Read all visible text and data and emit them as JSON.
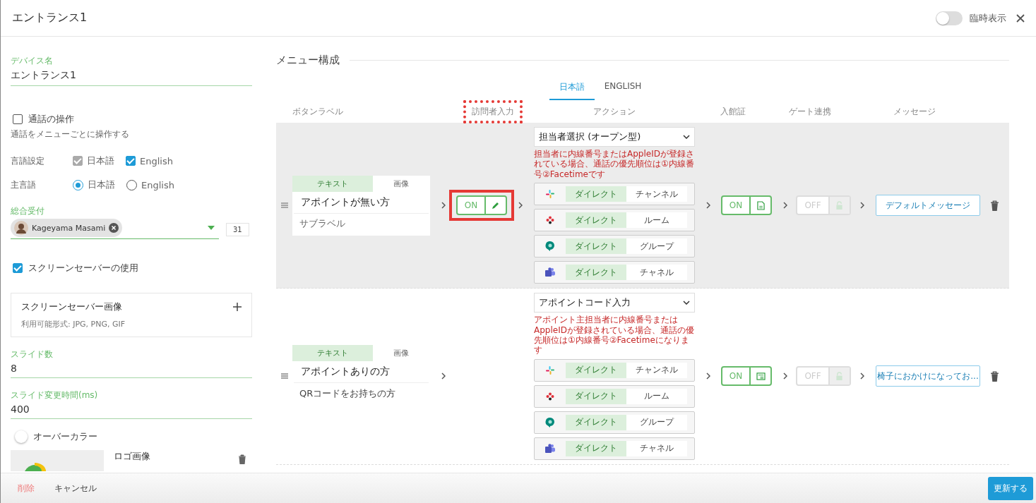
{
  "window": {
    "title": "エントランス1",
    "temp_display": {
      "label": "臨時表示",
      "on": false
    }
  },
  "settings": {
    "device_name": {
      "label": "デバイス名",
      "value": "エントランス1"
    },
    "call_control": {
      "label": "通話の操作",
      "checked": false,
      "hint": "通話をメニューごとに操作する"
    },
    "languages": {
      "label": "言語設定",
      "options": [
        {
          "label": "日本語",
          "checked": true,
          "disabled": true
        },
        {
          "label": "English",
          "checked": true,
          "disabled": false
        }
      ]
    },
    "main_language": {
      "label": "主言語",
      "options": [
        {
          "label": "日本語",
          "selected": true
        },
        {
          "label": "English",
          "selected": false
        }
      ]
    },
    "reception": {
      "label": "総合受付",
      "chips": [
        "Kageyama Masami"
      ],
      "count": "31"
    },
    "screensaver": {
      "label": "スクリーンセーバーの使用",
      "checked": true
    },
    "screensaver_image": {
      "title": "スクリーンセーバー画像",
      "hint": "利用可能形式: JPG, PNG, GIF"
    },
    "slide_count": {
      "label": "スライド数",
      "value": "8"
    },
    "slide_interval": {
      "label": "スライド変更時間(ms)",
      "value": "400"
    },
    "over_color": {
      "label": "オーバーカラー",
      "on": false
    },
    "logo": {
      "label": "ロゴ画像",
      "kind": "picture"
    }
  },
  "menu": {
    "title": "メニュー構成",
    "language_tabs": [
      {
        "label": "日本語",
        "selected": true
      },
      {
        "label": "ENGLISH",
        "selected": false
      }
    ],
    "columns": [
      {
        "label": "ボタンラベル",
        "dotted_frame": false
      },
      {
        "label": "訪問者入力",
        "dotted_frame": true
      },
      {
        "label": "アクション",
        "dotted_frame": false
      },
      {
        "label": "入館証",
        "dotted_frame": false
      },
      {
        "label": "ゲート連携",
        "dotted_frame": false
      },
      {
        "label": "メッセージ",
        "dotted_frame": false
      }
    ],
    "rows": [
      {
        "highlighted": true,
        "label_mode_tabs": [
          {
            "label": "テキスト",
            "selected": true
          },
          {
            "label": "画像",
            "selected": false
          }
        ],
        "label": "アポイントが無い方",
        "sublabel": {
          "placeholder": "サブラベル"
        },
        "visitor_input": {
          "label": "ON",
          "on": true,
          "framed": true
        },
        "action": {
          "value": "担当者選択 (オープン型)",
          "note": "担当者に内線番号またはAppleIDが登録されている場合、通話の優先順位は①内線番号②Facetimeです",
          "channels": [
            {
              "kind": "pinwheel",
              "options": [
                {
                  "label": "ダイレクト",
                  "selected": true
                },
                {
                  "label": "チャンネル",
                  "selected": false
                }
              ]
            },
            {
              "kind": "flower",
              "options": [
                {
                  "label": "ダイレクト",
                  "selected": true
                },
                {
                  "label": "ルーム",
                  "selected": false
                }
              ]
            },
            {
              "kind": "bubble",
              "options": [
                {
                  "label": "ダイレクト",
                  "selected": true
                },
                {
                  "label": "グループ",
                  "selected": false
                }
              ]
            },
            {
              "kind": "team",
              "options": [
                {
                  "label": "ダイレクト",
                  "selected": true
                },
                {
                  "label": "チャネル",
                  "selected": false
                }
              ]
            }
          ]
        },
        "pass": {
          "label": "ON",
          "on": true,
          "kind": "document"
        },
        "gate": {
          "label": "OFF",
          "disabled": true
        },
        "message": "デフォルトメッセージ"
      },
      {
        "highlighted": false,
        "label_mode_tabs": [
          {
            "label": "テキスト",
            "selected": true
          },
          {
            "label": "画像",
            "selected": false
          }
        ],
        "label": "アポイントありの方",
        "sublabel": {
          "value": "QRコードをお持ちの方"
        },
        "action": {
          "value": "アポイントコード入力",
          "note": "アポイント主担当者に内線番号またはAppleIDが登録されている場合、通話の優先順位は①内線番号②Facetimeになります",
          "channels": [
            {
              "kind": "pinwheel",
              "options": [
                {
                  "label": "ダイレクト",
                  "selected": true
                },
                {
                  "label": "チャンネル",
                  "selected": false
                }
              ]
            },
            {
              "kind": "flower",
              "options": [
                {
                  "label": "ダイレクト",
                  "selected": true
                },
                {
                  "label": "ルーム",
                  "selected": false
                }
              ]
            },
            {
              "kind": "bubble",
              "options": [
                {
                  "label": "ダイレクト",
                  "selected": true
                },
                {
                  "label": "グループ",
                  "selected": false
                }
              ]
            },
            {
              "kind": "team",
              "options": [
                {
                  "label": "ダイレクト",
                  "selected": true
                },
                {
                  "label": "チャネル",
                  "selected": false
                }
              ]
            }
          ]
        },
        "pass": {
          "label": "ON",
          "on": true,
          "kind": "card"
        },
        "gate": {
          "label": "OFF",
          "disabled": true
        },
        "message": "椅子におかけになってお..."
      }
    ]
  },
  "footer": {
    "delete": "削除",
    "cancel": "キャンセル",
    "update": "更新する"
  }
}
